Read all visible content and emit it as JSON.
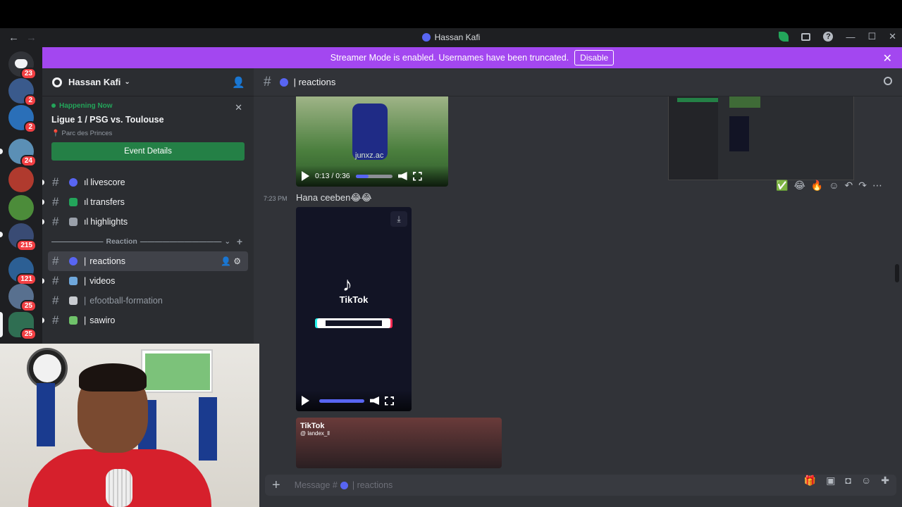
{
  "window": {
    "title": "Hassan Kafi"
  },
  "banner": {
    "text": "Streamer Mode is enabled. Usernames have been truncated.",
    "button": "Disable"
  },
  "guilds": [
    {
      "badge": "23",
      "color": "#313338"
    },
    {
      "badge": "2",
      "color": "#3a5a8c"
    },
    {
      "badge": "2",
      "color": "#2a6fb8"
    },
    {
      "badge": "24",
      "color": "#5b8fb5"
    },
    {
      "badge": "",
      "color": "#b03a2e"
    },
    {
      "badge": "",
      "color": "#4c8c3a"
    },
    {
      "badge": "215",
      "color": "#394b74"
    },
    {
      "badge": "121",
      "color": "#2c5f94"
    },
    {
      "badge": "25",
      "color": "#58708f"
    },
    {
      "badge": "25",
      "color": "#2f6e52"
    }
  ],
  "server": {
    "name": "Hassan Kafi",
    "event": {
      "status": "Happening Now",
      "name": "Ligue 1 / PSG vs. Toulouse",
      "location": "Parc des Princes",
      "button": "Event Details"
    },
    "channels_top": [
      {
        "name": "livescore",
        "prefix": "ıl",
        "color": "#5865f2"
      },
      {
        "name": "transfers",
        "prefix": "ıl",
        "color": "#23a55a"
      },
      {
        "name": "highlights",
        "prefix": "ıl",
        "color": "#9aa0aa"
      }
    ],
    "category": "Reaction",
    "channels_reaction": [
      {
        "name": "reactions",
        "prefix": "|",
        "color": "#5865f2"
      },
      {
        "name": "videos",
        "prefix": "|",
        "color": "#6fa8dc"
      },
      {
        "name": "efootball-formation",
        "prefix": "|",
        "color": "#c9ccd1"
      },
      {
        "name": "sawiro",
        "prefix": "|",
        "color": "#6fc26a"
      }
    ]
  },
  "chat": {
    "channel": "| reactions",
    "video1": {
      "watermark": "junxz.ac",
      "time": "0:13 / 0:36",
      "progress": 0.36
    },
    "message": {
      "time": "7:23 PM",
      "text": "Hana ceeben😂😂"
    },
    "tiktok_label": "TikTok",
    "video3": {
      "brand": "TikTok",
      "handle": "@ landex_ll"
    },
    "reactions": [
      "✅",
      "😂",
      "🔥"
    ],
    "composer_placeholder": "Message #",
    "composer_channel": "| reactions"
  },
  "colors": {
    "accent": "#5865f2",
    "banner": "#a347f0",
    "event_button": "#248046",
    "badge": "#f23f43"
  }
}
